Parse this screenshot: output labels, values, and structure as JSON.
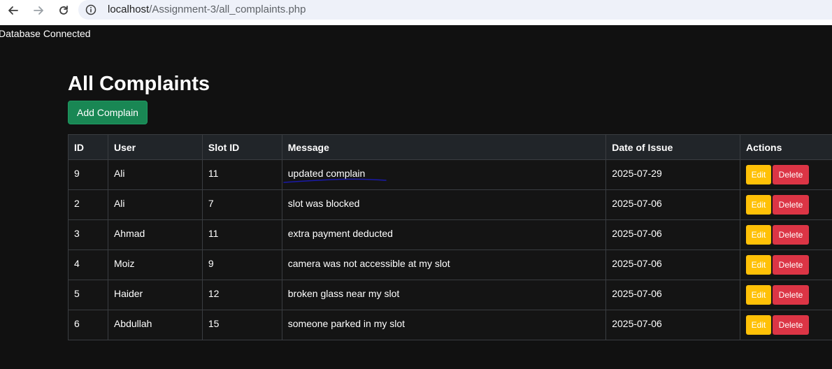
{
  "browser": {
    "url_host": "localhost",
    "url_path": "/Assignment-3/all_complaints.php"
  },
  "status_text": "Database Connected",
  "page": {
    "title": "All Complaints",
    "add_button": "Add Complain"
  },
  "table": {
    "headers": [
      "ID",
      "User",
      "Slot ID",
      "Message",
      "Date of Issue",
      "Actions"
    ],
    "rows": [
      {
        "id": "9",
        "user": "Ali",
        "slot": "11",
        "message": "updated complain",
        "date": "2025-07-29"
      },
      {
        "id": "2",
        "user": "Ali",
        "slot": "7",
        "message": "slot was blocked",
        "date": "2025-07-06"
      },
      {
        "id": "3",
        "user": "Ahmad",
        "slot": "11",
        "message": "extra payment deducted",
        "date": "2025-07-06"
      },
      {
        "id": "4",
        "user": "Moiz",
        "slot": "9",
        "message": "camera was not accessible at my slot",
        "date": "2025-07-06"
      },
      {
        "id": "5",
        "user": "Haider",
        "slot": "12",
        "message": "broken glass near my slot",
        "date": "2025-07-06"
      },
      {
        "id": "6",
        "user": "Abdullah",
        "slot": "15",
        "message": "someone parked in my slot",
        "date": "2025-07-06"
      }
    ],
    "edit_label": "Edit",
    "delete_label": "Delete"
  },
  "colors": {
    "background": "#111111",
    "success": "#198754",
    "warning": "#ffc107",
    "danger": "#dc3545",
    "annotation": "#1a1aa8"
  }
}
